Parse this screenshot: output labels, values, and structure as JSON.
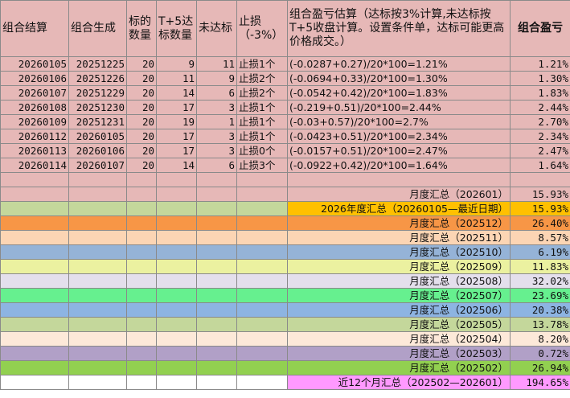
{
  "headers": {
    "c1": "组合结算",
    "c2": "组合生成",
    "c3": "标的数量",
    "c4": "T+5达标数量",
    "c5": "未达标",
    "c6": "止损（-3%）",
    "c7": "组合盈亏估算（达标按3%计算,未达标按T+5收盘计算。设置条件单，达标可能更高价格成交。）",
    "c8": "组合盈亏"
  },
  "rows": [
    {
      "settle": "20260105",
      "gen": "20251225",
      "count": "20",
      "hit": "9",
      "miss": "11",
      "stop": "止损1个",
      "calc": "(-0.0287+0.27)/20*100=1.21%",
      "pnl": "1.21%"
    },
    {
      "settle": "20260106",
      "gen": "20251226",
      "count": "20",
      "hit": "11",
      "miss": "9",
      "stop": "止损2个",
      "calc": "(-0.0694+0.33)/20*100=1.30%",
      "pnl": "1.30%"
    },
    {
      "settle": "20260107",
      "gen": "20251229",
      "count": "20",
      "hit": "14",
      "miss": "6",
      "stop": "止损2个",
      "calc": "(-0.0542+0.42)/20*100=1.83%",
      "pnl": "1.83%"
    },
    {
      "settle": "20260108",
      "gen": "20251230",
      "count": "20",
      "hit": "17",
      "miss": "3",
      "stop": "止损1个",
      "calc": "(-0.219+0.51)/20*100=2.44%",
      "pnl": "2.44%"
    },
    {
      "settle": "20260109",
      "gen": "20251231",
      "count": "20",
      "hit": "19",
      "miss": "1",
      "stop": "止损1个",
      "calc": "(-0.03+0.57)/20*100=2.7%",
      "pnl": "2.70%"
    },
    {
      "settle": "20260112",
      "gen": "20260105",
      "count": "20",
      "hit": "17",
      "miss": "3",
      "stop": "止损1个",
      "calc": "(-0.0423+0.51)/20*100=2.34%",
      "pnl": "2.34%"
    },
    {
      "settle": "20260113",
      "gen": "20260106",
      "count": "20",
      "hit": "17",
      "miss": "3",
      "stop": "止损0个",
      "calc": "(-0.0157+0.51)/20*100=2.47%",
      "pnl": "2.47%"
    },
    {
      "settle": "20260114",
      "gen": "20260107",
      "count": "20",
      "hit": "14",
      "miss": "6",
      "stop": "止损3个",
      "calc": "(-0.0922+0.42)/20*100=1.64%",
      "pnl": "1.64%"
    }
  ],
  "summaries": [
    {
      "label": "月度汇总（202601）",
      "value": "15.93%",
      "row_color": "#e6b8b7",
      "label_color": "#e6b8b7"
    },
    {
      "label": "2026年度汇总（20260105—最近日期）",
      "value": "15.93%",
      "row_color": "#c4d79b",
      "label_color": "#ffc000"
    },
    {
      "label": "月度汇总（202512）",
      "value": "26.40%",
      "row_color": "#f79646",
      "label_color": "#f79646"
    },
    {
      "label": "月度汇总（202511）",
      "value": "8.57%",
      "row_color": "#fcd5b4",
      "label_color": "#fcd5b4"
    },
    {
      "label": "月度汇总（202510）",
      "value": "6.19%",
      "row_color": "#95b3d7",
      "label_color": "#95b3d7"
    },
    {
      "label": "月度汇总（202509）",
      "value": "11.83%",
      "row_color": "#ebf1a0",
      "label_color": "#ebf1a0"
    },
    {
      "label": "月度汇总（202508）",
      "value": "32.02%",
      "row_color": "#e4dfec",
      "label_color": "#e4dfec"
    },
    {
      "label": "月度汇总（202507）",
      "value": "23.69%",
      "row_color": "#66f08f",
      "label_color": "#66f08f"
    },
    {
      "label": "月度汇总（202506）",
      "value": "20.38%",
      "row_color": "#8db4e2",
      "label_color": "#8db4e2"
    },
    {
      "label": "月度汇总（202505）",
      "value": "13.78%",
      "row_color": "#c4d79b",
      "label_color": "#c4d79b"
    },
    {
      "label": "月度汇总（202504）",
      "value": "8.20%",
      "row_color": "#fde9d9",
      "label_color": "#fde9d9"
    },
    {
      "label": "月度汇总（202503）",
      "value": "0.72%",
      "row_color": "#b1a0c7",
      "label_color": "#b1a0c7"
    },
    {
      "label": "月度汇总（202502）",
      "value": "26.94%",
      "row_color": "#92d050",
      "label_color": "#92d050"
    },
    {
      "label": "近12个月汇总（202502—202601）",
      "value": "194.65%",
      "row_color": "#ffffff",
      "label_color": "#ff99ff"
    }
  ]
}
